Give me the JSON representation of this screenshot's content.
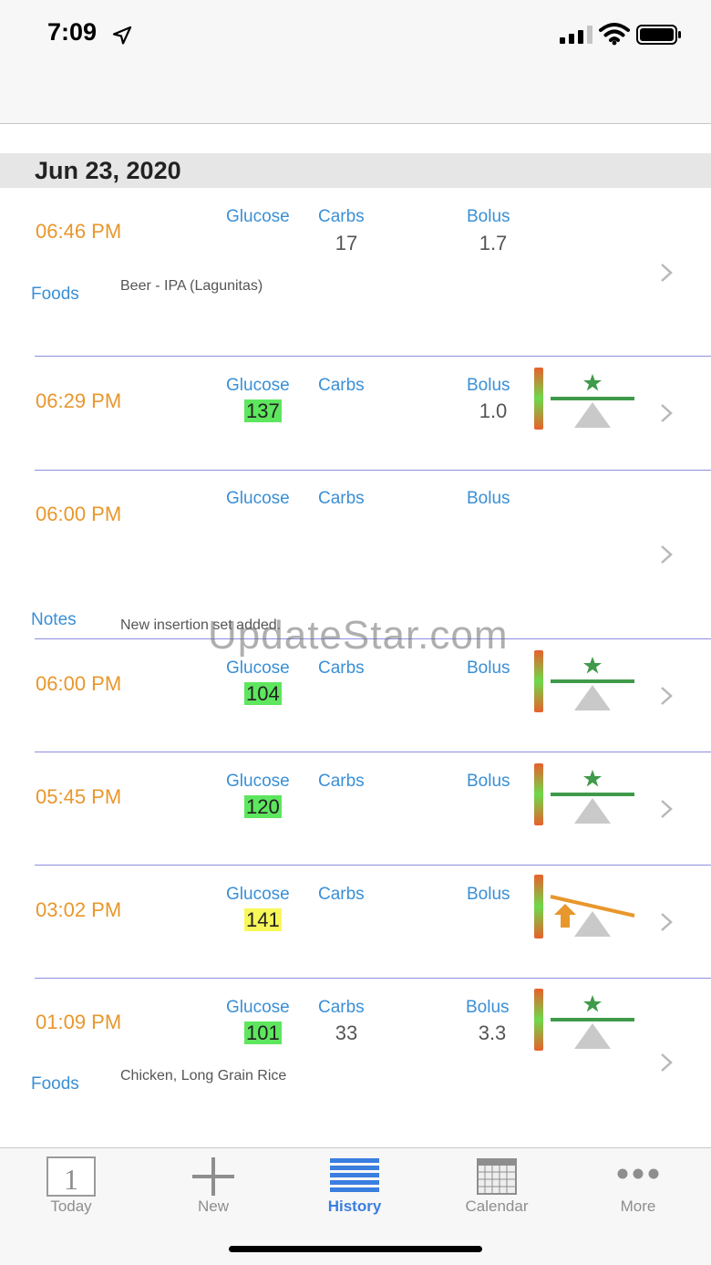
{
  "status": {
    "time": "7:09"
  },
  "date_header": "Jun 23, 2020",
  "labels": {
    "glucose": "Glucose",
    "carbs": "Carbs",
    "bolus": "Bolus"
  },
  "entries": [
    {
      "time": "06:46 PM",
      "glucose": "",
      "carbs": "17",
      "bolus": "1.7",
      "side_label": "Foods",
      "side_text": "Beer - IPA (Lagunitas)"
    },
    {
      "time": "06:29 PM",
      "glucose": "137",
      "glucose_color": "#5ee65e",
      "carbs": "",
      "bolus": "1.0",
      "meter": "balanced"
    },
    {
      "time": "06:00 PM",
      "glucose": "",
      "carbs": "",
      "bolus": "",
      "side_label": "Notes",
      "side_text": "New insertion set added."
    },
    {
      "time": "06:00 PM",
      "glucose": "104",
      "glucose_color": "#5ee65e",
      "carbs": "",
      "bolus": "",
      "meter": "balanced"
    },
    {
      "time": "05:45 PM",
      "glucose": "120",
      "glucose_color": "#5ee65e",
      "carbs": "",
      "bolus": "",
      "meter": "balanced"
    },
    {
      "time": "03:02 PM",
      "glucose": "141",
      "glucose_color": "#f7f75a",
      "carbs": "",
      "bolus": "",
      "meter": "tilted-up-arrow"
    },
    {
      "time": "01:09 PM",
      "glucose": "101",
      "glucose_color": "#5ee65e",
      "carbs": "33",
      "bolus": "3.3",
      "meter": "balanced",
      "side_label": "Foods",
      "side_text": "Chicken, Long Grain Rice"
    }
  ],
  "watermark": "UpdateStar.com",
  "tabbar": {
    "today_number": "1",
    "items": [
      {
        "label": "Today",
        "icon": "calendar-day-icon"
      },
      {
        "label": "New",
        "icon": "plus-icon"
      },
      {
        "label": "History",
        "icon": "list-icon",
        "active": true
      },
      {
        "label": "Calendar",
        "icon": "calendar-grid-icon"
      },
      {
        "label": "More",
        "icon": "ellipsis-icon"
      }
    ]
  },
  "colors": {
    "time_orange": "#e8972c",
    "label_blue": "#3a8fd6",
    "active_tab": "#3a7ee0",
    "meter_green": "#3f9a4a",
    "meter_orange": "#e8972c"
  }
}
